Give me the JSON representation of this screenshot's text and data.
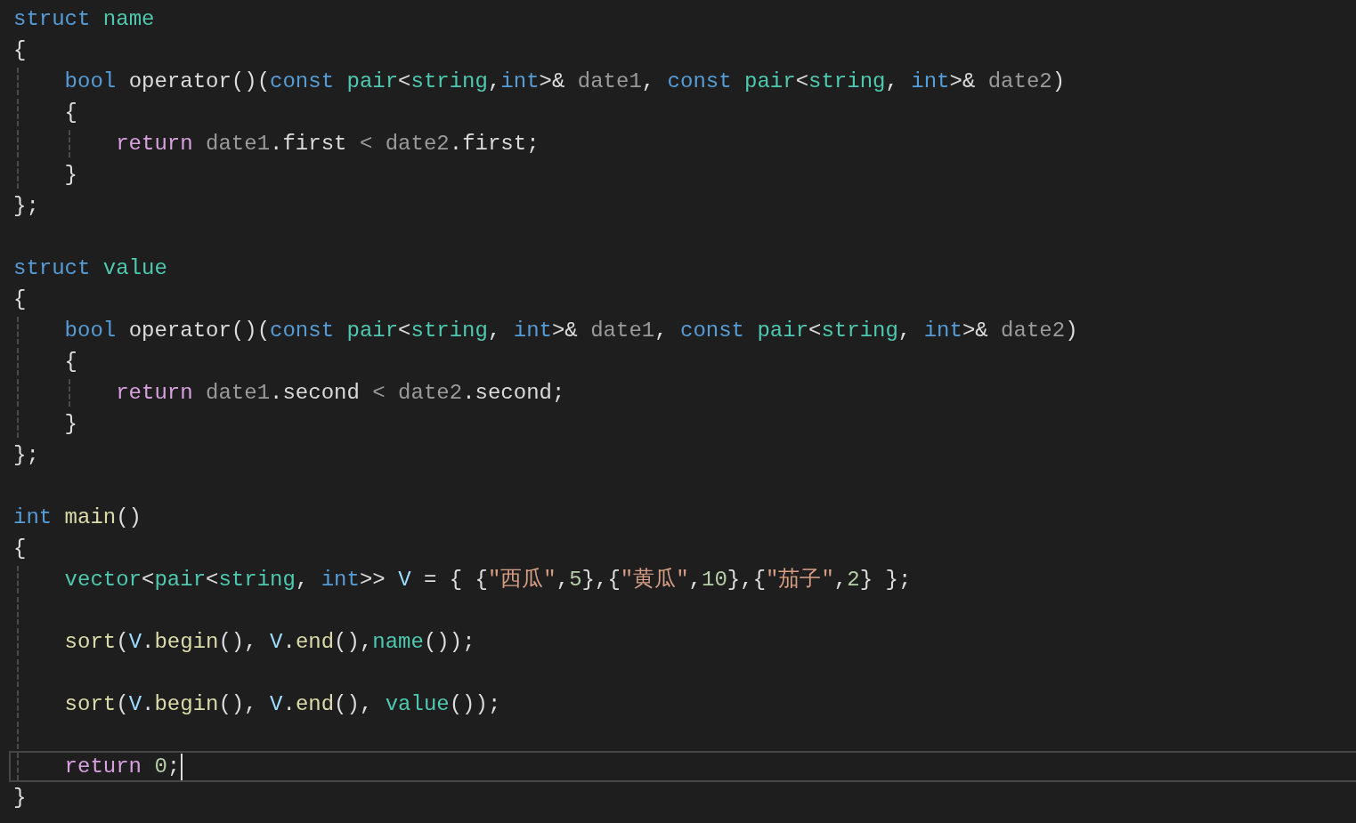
{
  "editor": {
    "lines": [
      {
        "kind": "code",
        "tokens": [
          {
            "text": "struct ",
            "kind": "keyword"
          },
          {
            "text": "name",
            "kind": "type"
          }
        ]
      },
      {
        "kind": "code",
        "tokens": [
          {
            "text": "{"
          }
        ]
      },
      {
        "kind": "code",
        "tokens": [
          {
            "text": "    bool ",
            "kind": "keyword"
          },
          {
            "text": "operator()("
          },
          {
            "text": "const ",
            "kind": "keyword"
          },
          {
            "text": "pair",
            "kind": "type"
          },
          {
            "text": "<"
          },
          {
            "text": "string",
            "kind": "type"
          },
          {
            "text": ","
          },
          {
            "text": "int",
            "kind": "keyword"
          },
          {
            "text": ">& "
          },
          {
            "text": "date1",
            "kind": "param"
          },
          {
            "text": ", "
          },
          {
            "text": "const ",
            "kind": "keyword"
          },
          {
            "text": "pair",
            "kind": "type"
          },
          {
            "text": "<"
          },
          {
            "text": "string",
            "kind": "type"
          },
          {
            "text": ", "
          },
          {
            "text": "int",
            "kind": "keyword"
          },
          {
            "text": ">& "
          },
          {
            "text": "date2",
            "kind": "param"
          },
          {
            "text": ")"
          }
        ]
      },
      {
        "kind": "code",
        "tokens": [
          {
            "text": "    {"
          }
        ]
      },
      {
        "kind": "code",
        "tokens": [
          {
            "text": "        return ",
            "kind": "control"
          },
          {
            "text": "date1",
            "kind": "param"
          },
          {
            "text": "."
          },
          {
            "text": "first ",
            "kind": "member"
          },
          {
            "text": "< ",
            "kind": "param"
          },
          {
            "text": "date2",
            "kind": "param"
          },
          {
            "text": "."
          },
          {
            "text": "first",
            "kind": "member"
          },
          {
            "text": ";"
          }
        ]
      },
      {
        "kind": "code",
        "tokens": [
          {
            "text": "    }"
          }
        ]
      },
      {
        "kind": "code",
        "tokens": [
          {
            "text": "};"
          }
        ]
      },
      {
        "kind": "blank"
      },
      {
        "kind": "code",
        "tokens": [
          {
            "text": "struct ",
            "kind": "keyword"
          },
          {
            "text": "value",
            "kind": "type"
          }
        ]
      },
      {
        "kind": "code",
        "tokens": [
          {
            "text": "{"
          }
        ]
      },
      {
        "kind": "code",
        "tokens": [
          {
            "text": "    bool ",
            "kind": "keyword"
          },
          {
            "text": "operator()("
          },
          {
            "text": "const ",
            "kind": "keyword"
          },
          {
            "text": "pair",
            "kind": "type"
          },
          {
            "text": "<"
          },
          {
            "text": "string",
            "kind": "type"
          },
          {
            "text": ", "
          },
          {
            "text": "int",
            "kind": "keyword"
          },
          {
            "text": ">& "
          },
          {
            "text": "date1",
            "kind": "param"
          },
          {
            "text": ", "
          },
          {
            "text": "const ",
            "kind": "keyword"
          },
          {
            "text": "pair",
            "kind": "type"
          },
          {
            "text": "<"
          },
          {
            "text": "string",
            "kind": "type"
          },
          {
            "text": ", "
          },
          {
            "text": "int",
            "kind": "keyword"
          },
          {
            "text": ">& "
          },
          {
            "text": "date2",
            "kind": "param"
          },
          {
            "text": ")"
          }
        ]
      },
      {
        "kind": "code",
        "tokens": [
          {
            "text": "    {"
          }
        ]
      },
      {
        "kind": "code",
        "tokens": [
          {
            "text": "        return ",
            "kind": "control"
          },
          {
            "text": "date1",
            "kind": "param"
          },
          {
            "text": "."
          },
          {
            "text": "second ",
            "kind": "member"
          },
          {
            "text": "< ",
            "kind": "param"
          },
          {
            "text": "date2",
            "kind": "param"
          },
          {
            "text": "."
          },
          {
            "text": "second",
            "kind": "member"
          },
          {
            "text": ";"
          }
        ]
      },
      {
        "kind": "code",
        "tokens": [
          {
            "text": "    }"
          }
        ]
      },
      {
        "kind": "code",
        "tokens": [
          {
            "text": "};"
          }
        ]
      },
      {
        "kind": "blank"
      },
      {
        "kind": "code",
        "tokens": [
          {
            "text": "int ",
            "kind": "keyword"
          },
          {
            "text": "main",
            "kind": "func"
          },
          {
            "text": "()"
          }
        ]
      },
      {
        "kind": "code",
        "tokens": [
          {
            "text": "{"
          }
        ]
      },
      {
        "kind": "code",
        "tokens": [
          {
            "text": "    vector",
            "kind": "type"
          },
          {
            "text": "<"
          },
          {
            "text": "pair",
            "kind": "type"
          },
          {
            "text": "<"
          },
          {
            "text": "string",
            "kind": "type"
          },
          {
            "text": ", "
          },
          {
            "text": "int",
            "kind": "keyword"
          },
          {
            "text": ">> "
          },
          {
            "text": "V",
            "kind": "variable"
          },
          {
            "text": " = { {"
          },
          {
            "text": "\"西瓜\"",
            "kind": "string"
          },
          {
            "text": ","
          },
          {
            "text": "5",
            "kind": "number"
          },
          {
            "text": "},{"
          },
          {
            "text": "\"黄瓜\"",
            "kind": "string"
          },
          {
            "text": ","
          },
          {
            "text": "10",
            "kind": "number"
          },
          {
            "text": "},{"
          },
          {
            "text": "\"茄子\"",
            "kind": "string"
          },
          {
            "text": ","
          },
          {
            "text": "2",
            "kind": "number"
          },
          {
            "text": "} };"
          }
        ]
      },
      {
        "kind": "blank"
      },
      {
        "kind": "code",
        "tokens": [
          {
            "text": "    sort",
            "kind": "func"
          },
          {
            "text": "("
          },
          {
            "text": "V",
            "kind": "variable"
          },
          {
            "text": "."
          },
          {
            "text": "begin",
            "kind": "func"
          },
          {
            "text": "(), "
          },
          {
            "text": "V",
            "kind": "variable"
          },
          {
            "text": "."
          },
          {
            "text": "end",
            "kind": "func"
          },
          {
            "text": "(),"
          },
          {
            "text": "name",
            "kind": "type"
          },
          {
            "text": "());"
          }
        ]
      },
      {
        "kind": "blank"
      },
      {
        "kind": "code",
        "tokens": [
          {
            "text": "    sort",
            "kind": "func"
          },
          {
            "text": "("
          },
          {
            "text": "V",
            "kind": "variable"
          },
          {
            "text": "."
          },
          {
            "text": "begin",
            "kind": "func"
          },
          {
            "text": "(), "
          },
          {
            "text": "V",
            "kind": "variable"
          },
          {
            "text": "."
          },
          {
            "text": "end",
            "kind": "func"
          },
          {
            "text": "(), "
          },
          {
            "text": "value",
            "kind": "type"
          },
          {
            "text": "());"
          }
        ]
      },
      {
        "kind": "blank"
      },
      {
        "kind": "code",
        "tokens": [
          {
            "text": "    return ",
            "kind": "control"
          },
          {
            "text": "0",
            "kind": "number"
          },
          {
            "text": ";"
          }
        ],
        "current": true
      },
      {
        "kind": "code",
        "tokens": [
          {
            "text": "}"
          }
        ]
      }
    ]
  }
}
